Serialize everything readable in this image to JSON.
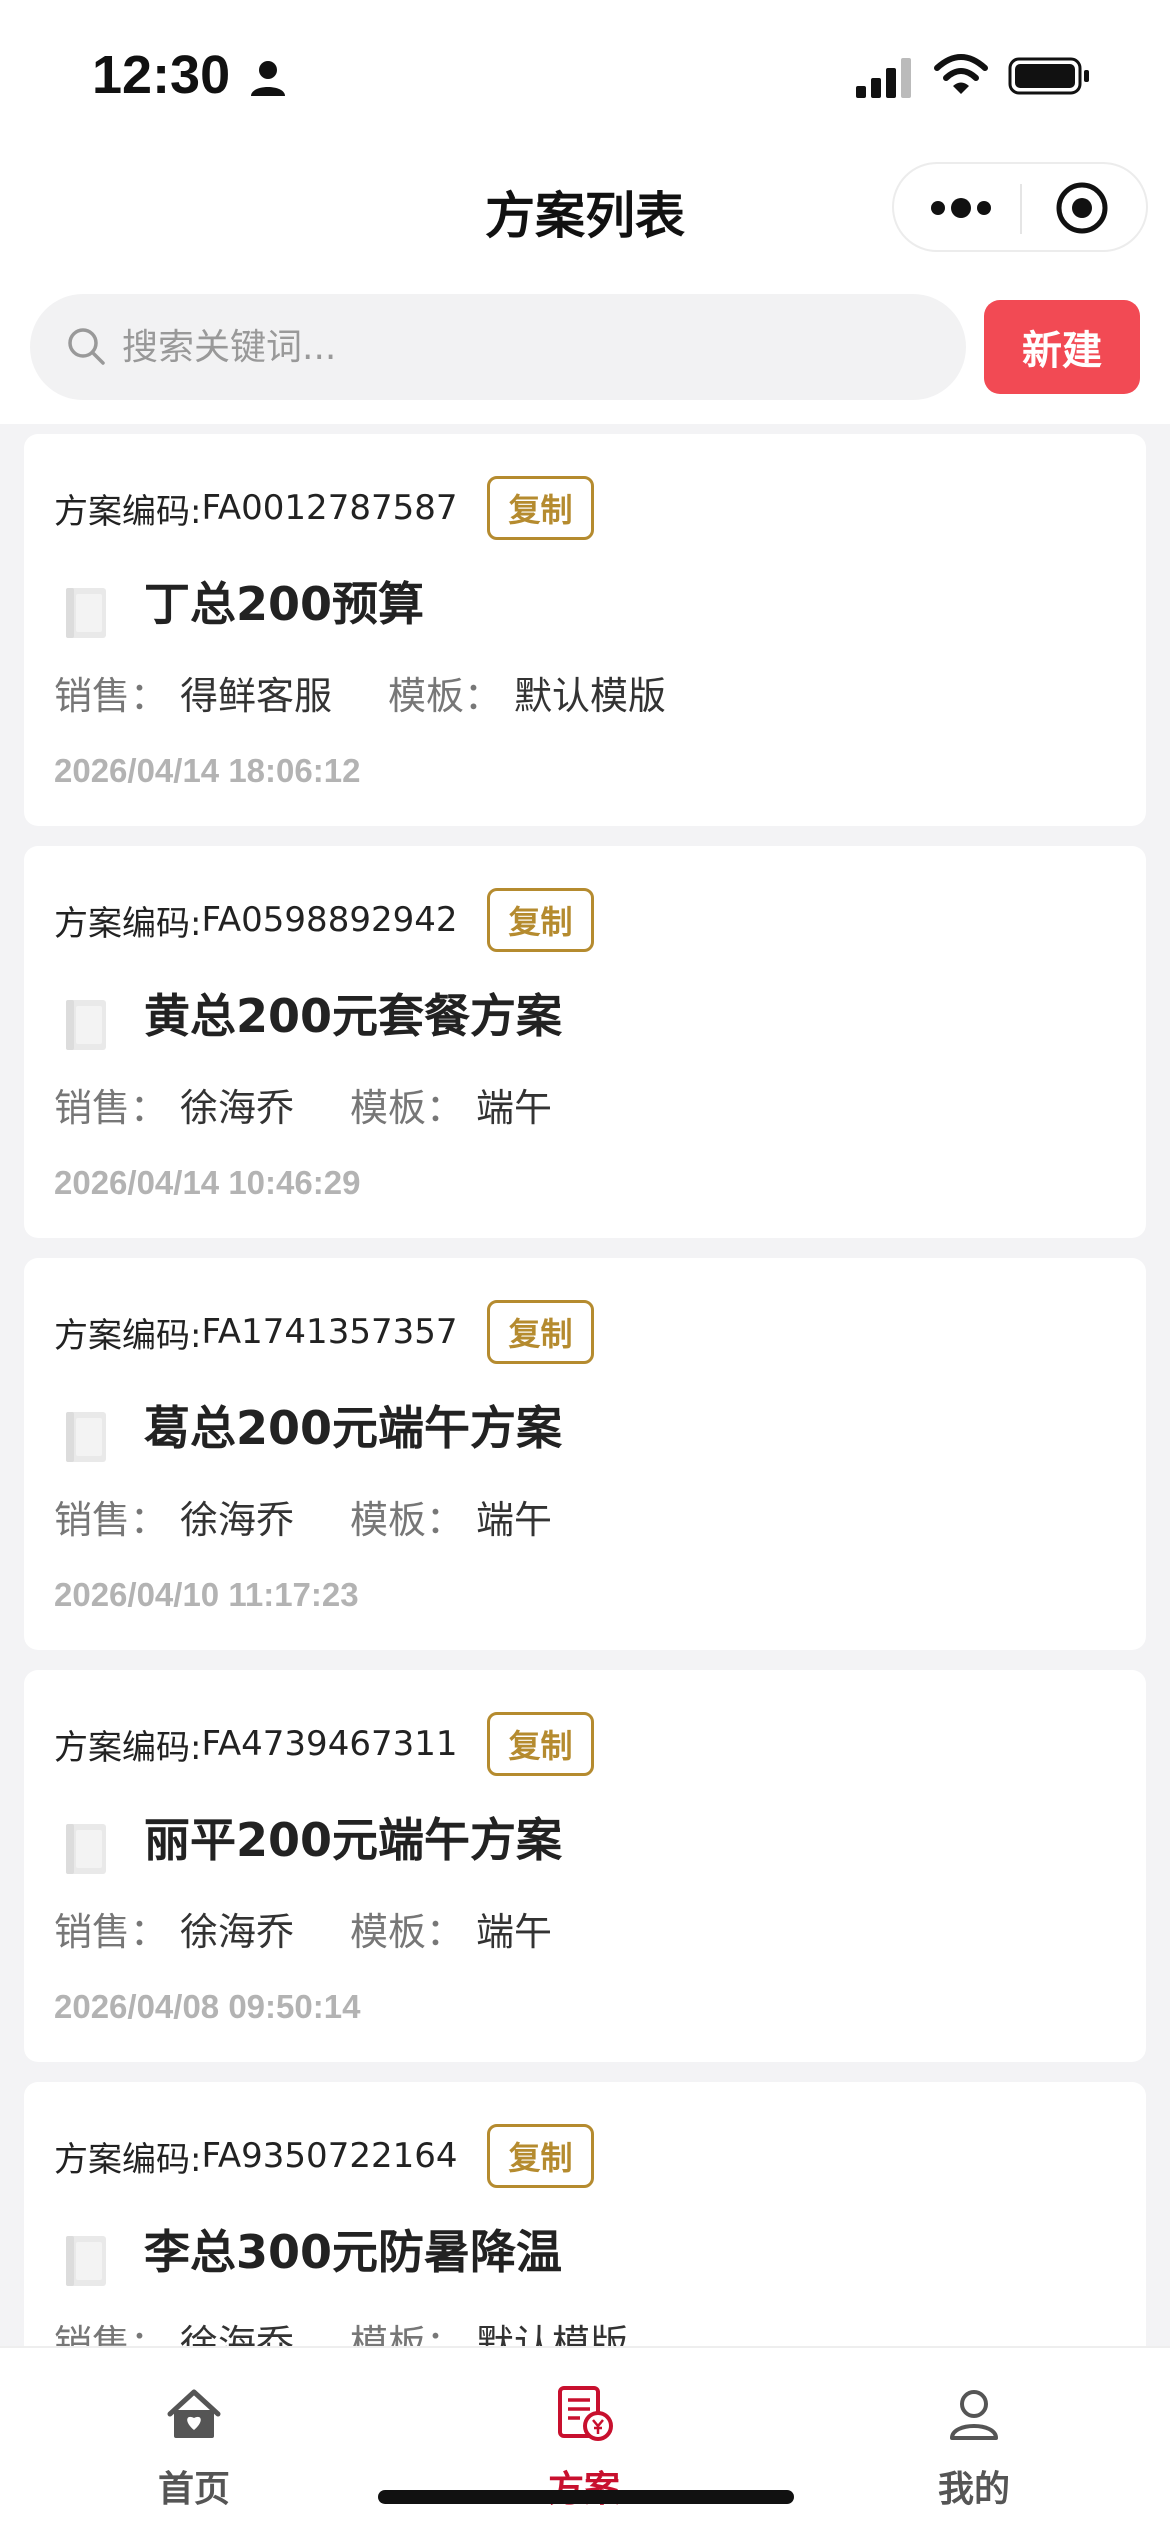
{
  "status_bar": {
    "time": "12:30",
    "icons": [
      "person-icon",
      "signal-icon",
      "wifi-icon",
      "battery-icon"
    ]
  },
  "nav": {
    "title": "方案列表",
    "capsule_icons": [
      "more-icon",
      "close-target-icon"
    ]
  },
  "search": {
    "placeholder": "搜索关键词...",
    "value": "",
    "new_label": "新建"
  },
  "colors": {
    "accent_red": "#f24a54",
    "copy_gold": "#b58b2f",
    "active_tab": "#c8102e"
  },
  "labels": {
    "code_label": "方案编码:",
    "copy_label": "复制",
    "sales_label": "销售：",
    "template_label": "模板："
  },
  "plans": [
    {
      "code": "FA0012787587",
      "title": "丁总200预算",
      "sales": "得鲜客服",
      "template": "默认模版",
      "time": "2026/04/14 18:06:12"
    },
    {
      "code": "FA0598892942",
      "title": "黄总200元套餐方案",
      "sales": "徐海乔",
      "template": "端午",
      "time": "2026/04/14 10:46:29"
    },
    {
      "code": "FA1741357357",
      "title": "葛总200元端午方案",
      "sales": "徐海乔",
      "template": "端午",
      "time": "2026/04/10 11:17:23"
    },
    {
      "code": "FA4739467311",
      "title": "丽平200元端午方案",
      "sales": "徐海乔",
      "template": "端午",
      "time": "2026/04/08 09:50:14"
    },
    {
      "code": "FA9350722164",
      "title": "李总300元防暑降温",
      "sales": "徐海乔",
      "template": "默认模版",
      "time": ""
    }
  ],
  "tabs": [
    {
      "label": "首页",
      "icon": "home-icon",
      "active": false
    },
    {
      "label": "方案",
      "icon": "plan-doc-icon",
      "active": true
    },
    {
      "label": "我的",
      "icon": "user-icon",
      "active": false
    }
  ]
}
